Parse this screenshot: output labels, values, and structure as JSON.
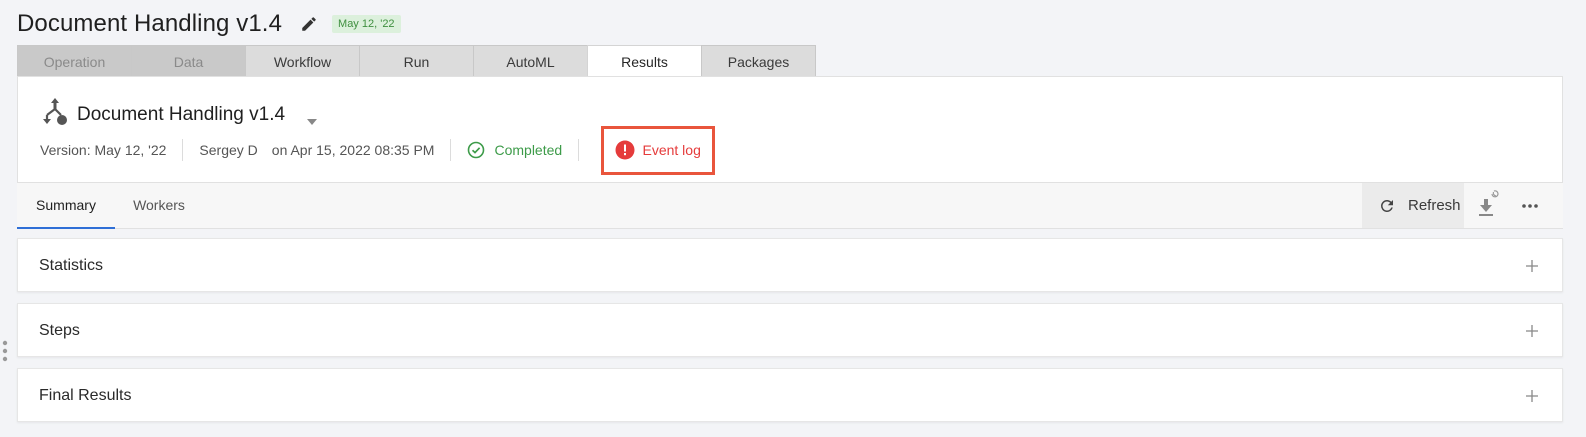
{
  "header": {
    "title": "Document Handling v1.4",
    "version_badge": "May 12, '22"
  },
  "tabs": [
    {
      "label": "Operation",
      "state": "disabled"
    },
    {
      "label": "Data",
      "state": "disabled"
    },
    {
      "label": "Workflow",
      "state": "normal"
    },
    {
      "label": "Run",
      "state": "normal"
    },
    {
      "label": "AutoML",
      "state": "normal"
    },
    {
      "label": "Results",
      "state": "active"
    },
    {
      "label": "Packages",
      "state": "normal"
    }
  ],
  "run": {
    "name": "Document Handling v1.4",
    "version": "Version: May 12, '22",
    "user": "Sergey D",
    "date": "on Apr 15, 2022 08:35 PM",
    "status": "Completed",
    "event_log": "Event log"
  },
  "subtabs": [
    {
      "label": "Summary",
      "active": true
    },
    {
      "label": "Workers",
      "active": false
    }
  ],
  "toolbar": {
    "refresh_label": "Refresh"
  },
  "panels": [
    {
      "title": "Statistics"
    },
    {
      "title": "Steps"
    },
    {
      "title": "Final Results"
    }
  ],
  "colors": {
    "status_success": "#3d9b49",
    "event_log_error": "#e53b3b",
    "highlight_border": "#e9553c",
    "active_tab_underline": "#2f6fd6",
    "version_badge_bg": "#dcf0dc"
  },
  "icons": {
    "edit": "pencil-icon",
    "flow": "workflow-icon",
    "status": "check-circle-icon",
    "event": "error-circle-icon",
    "refresh": "refresh-icon",
    "download": "download-icon",
    "more": "more-horizontal-icon",
    "expand": "plus-icon"
  }
}
